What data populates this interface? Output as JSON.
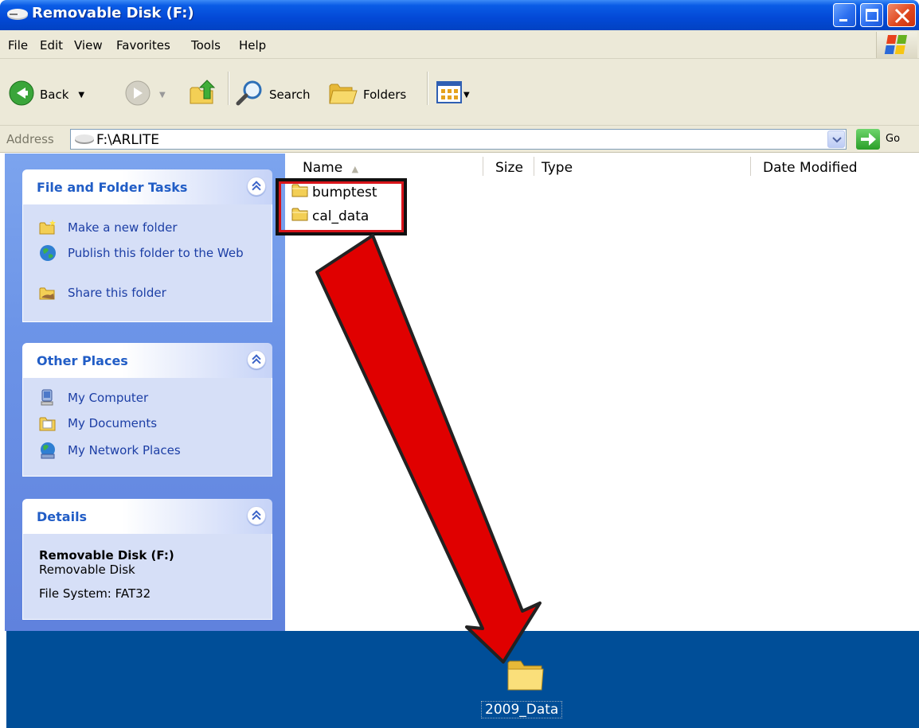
{
  "window": {
    "title": "Removable Disk (F:)"
  },
  "menu": [
    "File",
    "Edit",
    "View",
    "Favorites",
    "Tools",
    "Help"
  ],
  "toolbar": {
    "back_label": "Back",
    "search_label": "Search",
    "folders_label": "Folders"
  },
  "address": {
    "label": "Address",
    "value": "F:\\ARLITE",
    "go_label": "Go"
  },
  "taskpane": {
    "file_tasks": {
      "title": "File and Folder Tasks",
      "items": [
        "Make a new folder",
        "Publish this folder to the Web",
        "Share this folder"
      ]
    },
    "other_places": {
      "title": "Other Places",
      "items": [
        "My Computer",
        "My Documents",
        "My Network Places"
      ]
    },
    "details": {
      "title": "Details",
      "name": "Removable Disk (F:)",
      "type": "Removable Disk",
      "filesystem": "File System: FAT32"
    }
  },
  "filelist": {
    "columns": [
      "Name",
      "Size",
      "Type",
      "Date Modified"
    ],
    "items": [
      "bumptest",
      "cal_data"
    ]
  },
  "desktop": {
    "folder_label": "2009_Data"
  },
  "colors": {
    "title_blue": "#0a5ce6",
    "desktop_blue": "#004e98",
    "annotation_red": "#e00000",
    "link_blue": "#1c3ea5"
  }
}
